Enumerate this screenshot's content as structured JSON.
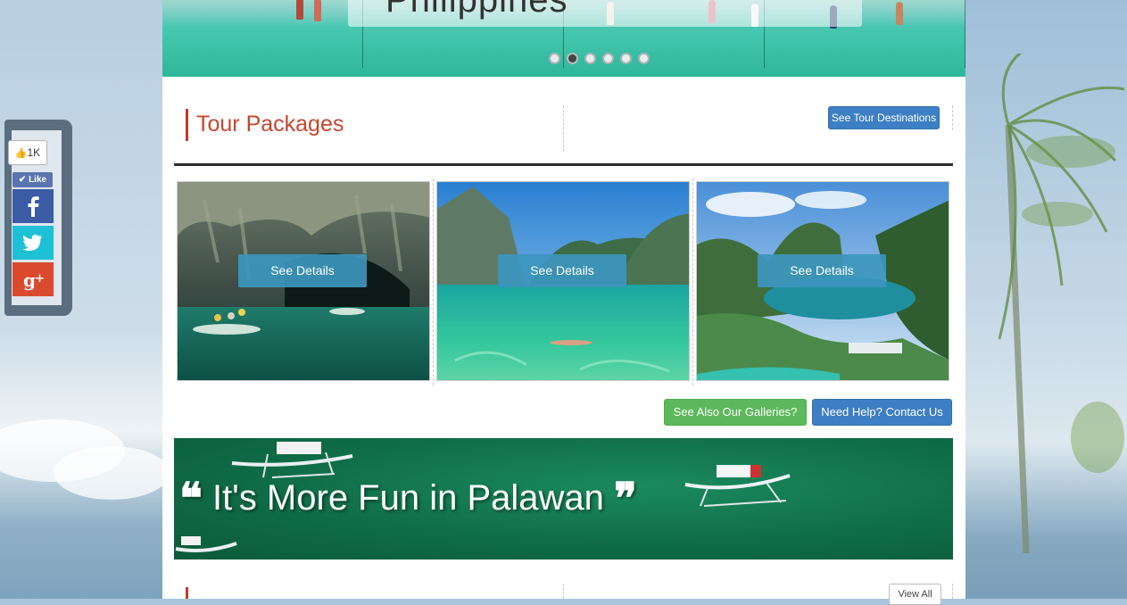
{
  "hero": {
    "caption": "Philippines",
    "slide_count": 6,
    "active_slide": 2
  },
  "section": {
    "title": "Tour Packages",
    "see_destinations_label": "See Tour Destinations"
  },
  "cards": [
    {
      "button_label": "See Details",
      "scene": "underground-river"
    },
    {
      "button_label": "See Details",
      "scene": "lagoon-snorkel"
    },
    {
      "button_label": "See Details",
      "scene": "island-lake"
    }
  ],
  "actions": {
    "galleries_label": "See Also Our Galleries?",
    "contact_label": "Need Help? Contact Us"
  },
  "banner": {
    "text": "It's More Fun in Palawan",
    "open_quote": "❝",
    "close_quote": "❞"
  },
  "bottom": {
    "view_all_label": "View All"
  },
  "share": {
    "like_count": "1K",
    "like_label": "Like",
    "networks": [
      "facebook",
      "twitter",
      "google-plus"
    ]
  },
  "colors": {
    "accent_red": "#c6452f",
    "button_blue": "#3d7fc4",
    "button_green": "#5cb85c",
    "facebook": "#3b5ba5",
    "twitter": "#1ec0d6",
    "google_plus": "#db4a2f"
  }
}
